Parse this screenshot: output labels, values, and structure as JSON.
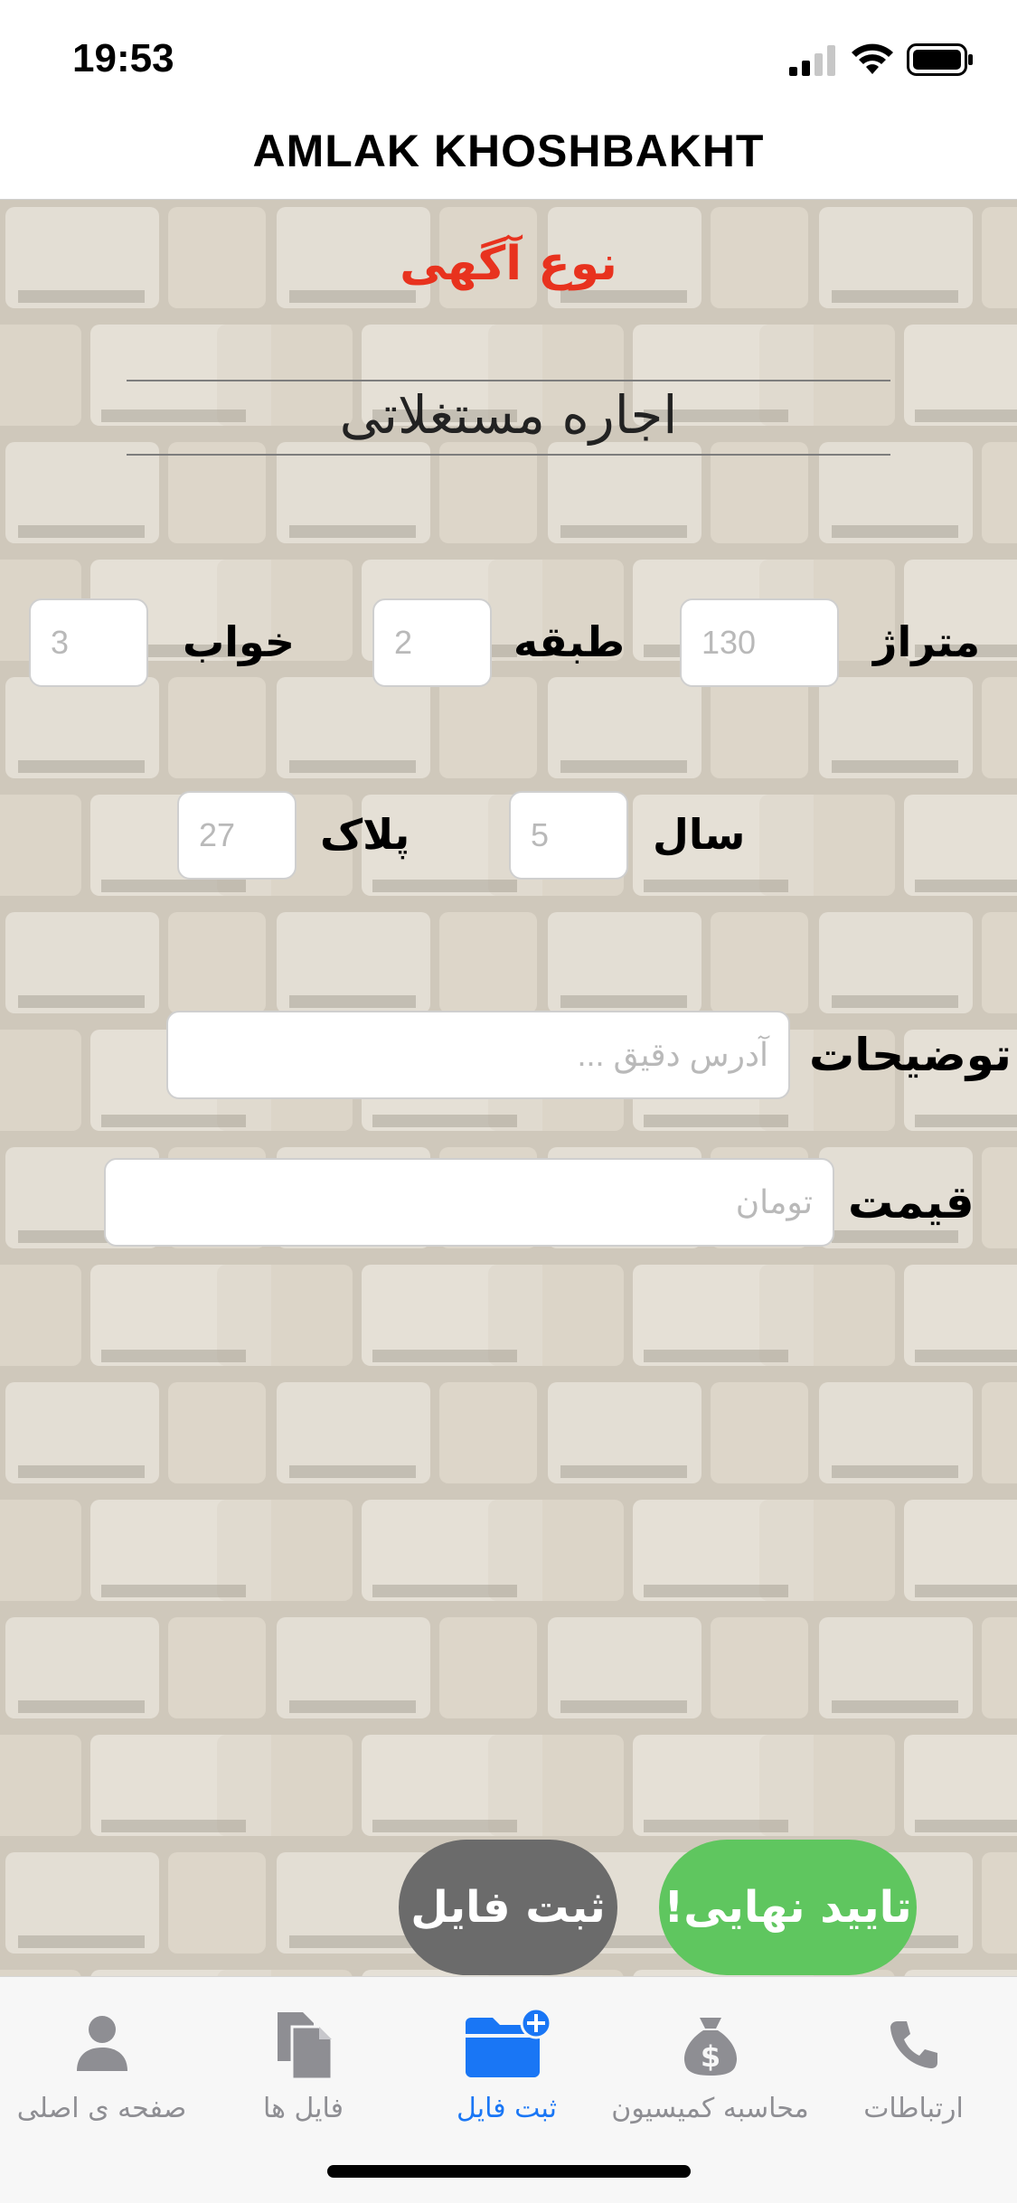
{
  "status_bar": {
    "time": "19:53"
  },
  "nav": {
    "title": "AMLAK KHOSHBAKHT"
  },
  "form": {
    "ad_type_label": "نوع آگهی",
    "ad_type_value": "اجاره مستغلاتی",
    "area_label": "متراژ",
    "area_placeholder": "130",
    "floor_label": "طبقه",
    "floor_placeholder": "2",
    "bedrooms_label": "خواب",
    "bedrooms_placeholder": "3",
    "year_label": "سال",
    "year_placeholder": "5",
    "plate_label": "پلاک",
    "plate_placeholder": "27",
    "description_label": "توضیحات",
    "description_placeholder": "آدرس دقیق ...",
    "price_label": "قیمت",
    "price_placeholder": "تومان"
  },
  "actions": {
    "submit_file": "ثبت فایل",
    "final_confirm": "تایید نهایی!"
  },
  "tabs": [
    {
      "label": "ارتباطات",
      "icon": "phone-icon"
    },
    {
      "label": "محاسبه کمیسیون",
      "icon": "money-bag-icon"
    },
    {
      "label": "ثبت فایل",
      "icon": "folder-add-icon",
      "active": true
    },
    {
      "label": "فایل ها",
      "icon": "files-icon"
    },
    {
      "label": "صفحه ی اصلی",
      "icon": "person-icon"
    }
  ],
  "colors": {
    "accent_red": "#e8321e",
    "confirm_green": "#5fc65f",
    "submit_gray": "#6b6b6b",
    "tab_active": "#1976f5"
  }
}
